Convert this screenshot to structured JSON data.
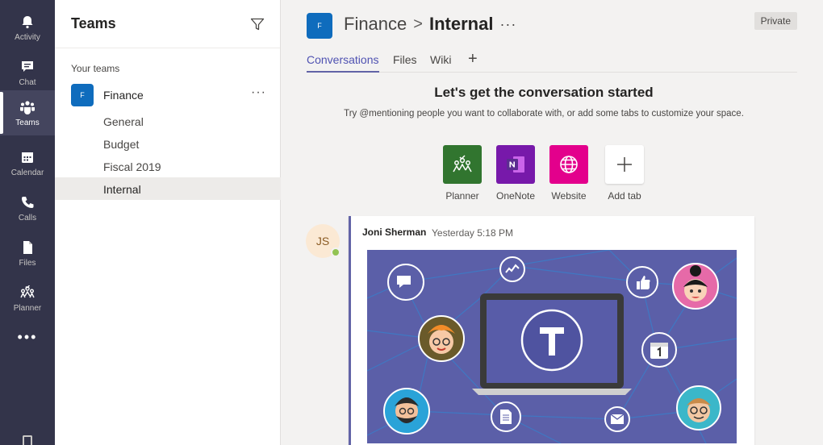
{
  "rail": {
    "items": [
      {
        "label": "Activity",
        "icon": "bell-icon"
      },
      {
        "label": "Chat",
        "icon": "chat-icon"
      },
      {
        "label": "Teams",
        "icon": "teams-icon"
      },
      {
        "label": "Calendar",
        "icon": "calendar-icon"
      },
      {
        "label": "Calls",
        "icon": "phone-icon"
      },
      {
        "label": "Files",
        "icon": "file-icon"
      },
      {
        "label": "Planner",
        "icon": "planner-icon"
      }
    ],
    "more": "•••"
  },
  "pane": {
    "title": "Teams",
    "section_label": "Your teams",
    "team": {
      "avatar": "F",
      "name": "Finance",
      "more": "···"
    },
    "channels": [
      "General",
      "Budget",
      "Fiscal 2019",
      "Internal"
    ]
  },
  "header": {
    "avatar": "F",
    "team": "Finance",
    "separator": ">",
    "channel": "Internal",
    "more": "···",
    "badge": "Private"
  },
  "tabs": {
    "items": [
      "Conversations",
      "Files",
      "Wiki"
    ],
    "add": "+"
  },
  "intro": {
    "title": "Let's get the conversation started",
    "subtitle": "Try @mentioning people you want to collaborate with, or add some tabs to customize your space."
  },
  "tiles": [
    {
      "label": "Planner",
      "color": "#31752f"
    },
    {
      "label": "OneNote",
      "color": "#7719aa"
    },
    {
      "label": "Website",
      "color": "#e3008c"
    },
    {
      "label": "Add tab",
      "color": "#ffffff"
    }
  ],
  "message": {
    "initials": "JS",
    "author": "Joni Sherman",
    "time": "Yesterday 5:18 PM",
    "image_bg": "#5b5fa8"
  },
  "colors": {
    "accent": "#6264a7",
    "rail": "#33344a",
    "team_avatar": "#0f6cbd"
  }
}
